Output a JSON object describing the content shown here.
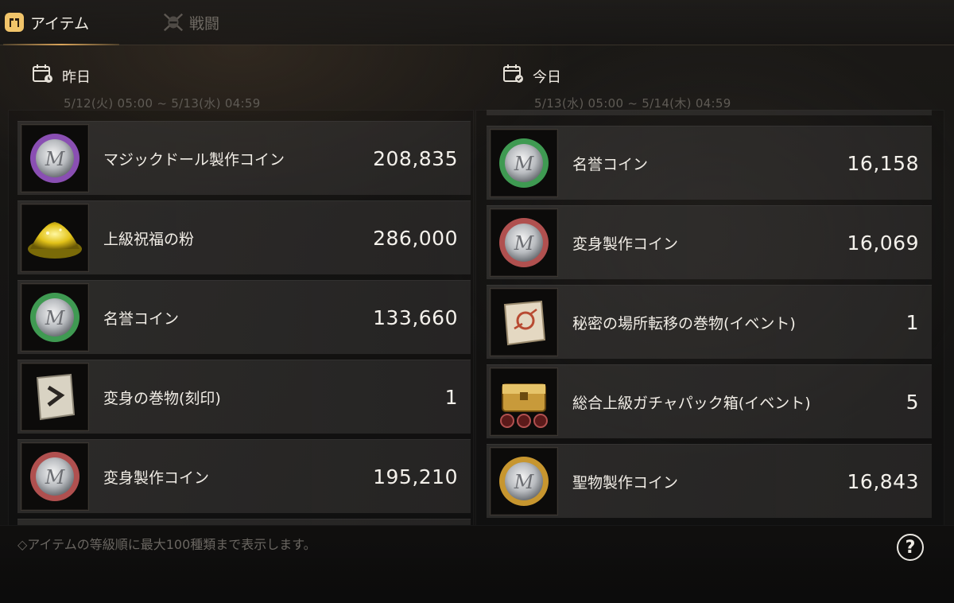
{
  "tabs": {
    "items": {
      "label": "アイテム"
    },
    "battle": {
      "label": "戦闘"
    }
  },
  "yesterday": {
    "title": "昨日",
    "range": "5/12(火) 05:00 ~ 5/13(水) 04:59",
    "rows": [
      {
        "name": "マジックドール製作コイン",
        "qty": "208,835",
        "icon": "purple-coin-icon"
      },
      {
        "name": "上級祝福の粉",
        "qty": "286,000",
        "icon": "gold-powder-icon"
      },
      {
        "name": "名誉コイン",
        "qty": "133,660",
        "icon": "green-coin-icon"
      },
      {
        "name": "変身の巻物(刻印)",
        "qty": "1",
        "icon": "scroll-icon"
      },
      {
        "name": "変身製作コイン",
        "qty": "195,210",
        "icon": "red-coin-icon"
      }
    ]
  },
  "today": {
    "title": "今日",
    "range": "5/13(水) 05:00 ~ 5/14(木) 04:59",
    "rows": [
      {
        "name": "名誉コイン",
        "qty": "16,158",
        "icon": "green-coin-icon"
      },
      {
        "name": "変身製作コイン",
        "qty": "16,069",
        "icon": "red-coin-icon"
      },
      {
        "name": "秘密の場所転移の巻物(イベント)",
        "qty": "1",
        "icon": "map-scroll-icon"
      },
      {
        "name": "総合上級ガチャパック箱(イベント)",
        "qty": "5",
        "icon": "treasure-chest-icon"
      },
      {
        "name": "聖物製作コイン",
        "qty": "16,843",
        "icon": "gold-coin-icon"
      }
    ]
  },
  "footer": {
    "note": "◇アイテムの等級順に最大100種類まで表示します。",
    "help_glyph": "?"
  },
  "colors": {
    "purple_coin": "#8a4fb3",
    "green_coin": "#3f9a52",
    "red_coin": "#b0504f",
    "gold_coin": "#c7962f",
    "accent": "#d9a45a"
  }
}
